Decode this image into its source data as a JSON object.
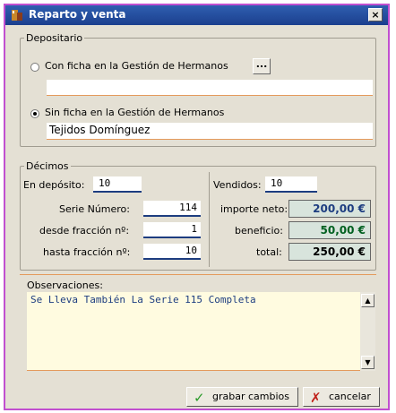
{
  "window": {
    "title": "Reparto y venta",
    "close_label": "×"
  },
  "depositario": {
    "legend": "Depositario",
    "option1_label": "Con ficha en la Gestión de Hermanos",
    "option1_value": "",
    "ellipsis_label": "...",
    "option2_label": "Sin ficha en la Gestión de Hermanos",
    "option2_value": "Tejidos Domínguez",
    "selected": "option2"
  },
  "decimos": {
    "legend": "Décimos",
    "en_deposito_label": "En depósito:",
    "en_deposito_value": "10",
    "serie_label": "Serie Número:",
    "serie_value": "114",
    "desde_label": "desde fracción nº:",
    "desde_value": "1",
    "hasta_label": "hasta fracción nº:",
    "hasta_value": "10",
    "vendidos_label": "Vendidos:",
    "vendidos_value": "10",
    "importe_label": "importe neto:",
    "importe_value": "200,00 €",
    "beneficio_label": "beneficio:",
    "beneficio_value": "50,00 €",
    "total_label": "total:",
    "total_value": "250,00 €"
  },
  "observaciones": {
    "label": "Observaciones:",
    "text": "Se Lleva También La Serie 115 Completa"
  },
  "buttons": {
    "save_label": "grabar cambios",
    "cancel_label": "cancelar"
  },
  "colors": {
    "title_bar": "#1b3f8e",
    "window_border": "#c14fd0",
    "accent_underline": "#e49a5c",
    "value_text_blue": "#1d3d80",
    "value_text_green": "#006020"
  }
}
